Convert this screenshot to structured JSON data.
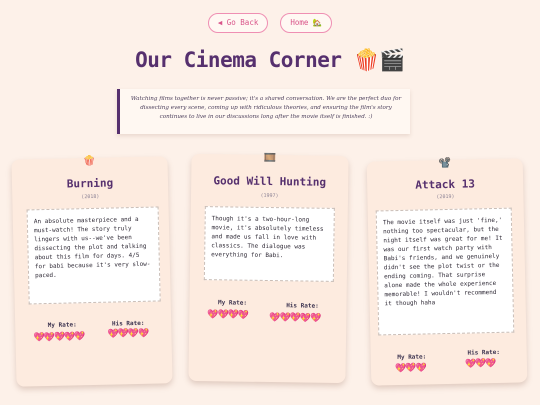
{
  "nav": {
    "back_label": "◀ Go Back",
    "home_label": "Home 🏡"
  },
  "page": {
    "title": "Our Cinema Corner 🍿🎬"
  },
  "intro": {
    "text": "Watching films together is never passive; it's a shared conversation. We are the perfect duo for dissecting every scene, coming up with ridiculous theories, and ensuring the film's story continues to live in our discussions long after the movie itself is finished. :)"
  },
  "movies": [
    {
      "icon": "🍿",
      "title": "Burning",
      "year": "(2018)",
      "review": "An absolute masterpiece and a must-watch! The story truly lingers with us--we've been dissecting the plot and talking about this film for days. 4/5 for babi because it's very slow-paced.",
      "my_rate_label": "My Rate:",
      "his_rate_label": "His Rate:",
      "my_rating": 5,
      "his_rating": 4,
      "my_hearts": "💖💖💖💖💖",
      "his_hearts": "💖💖💖💖"
    },
    {
      "icon": "🎞️",
      "title": "Good Will Hunting",
      "year": "(1997)",
      "review": "Though it's a two-hour-long movie, it's absolutely timeless and made us fall in love with classics. The dialogue was everything for Babi.",
      "my_rate_label": "My Rate:",
      "his_rate_label": "His Rate:",
      "my_rating": 4,
      "his_rating": 5,
      "my_hearts": "💖💖💖💖",
      "his_hearts": "💖💖💖💖💖"
    },
    {
      "icon": "📽️",
      "title": "Attack 13",
      "year": "(2019)",
      "review": "The movie itself was just 'fine,' nothing too spectacular, but the night itself was great for me! It was our first watch party with Babi's friends, and we genuinely didn't see the plot twist or the ending coming. That surprise alone made the whole experience memorable! I wouldn't recommend it though haha",
      "my_rate_label": "My Rate:",
      "his_rate_label": "His Rate:",
      "my_rating": 3,
      "his_rating": 3,
      "my_hearts": "💖💖💖",
      "his_hearts": "💖💖💖"
    }
  ]
}
